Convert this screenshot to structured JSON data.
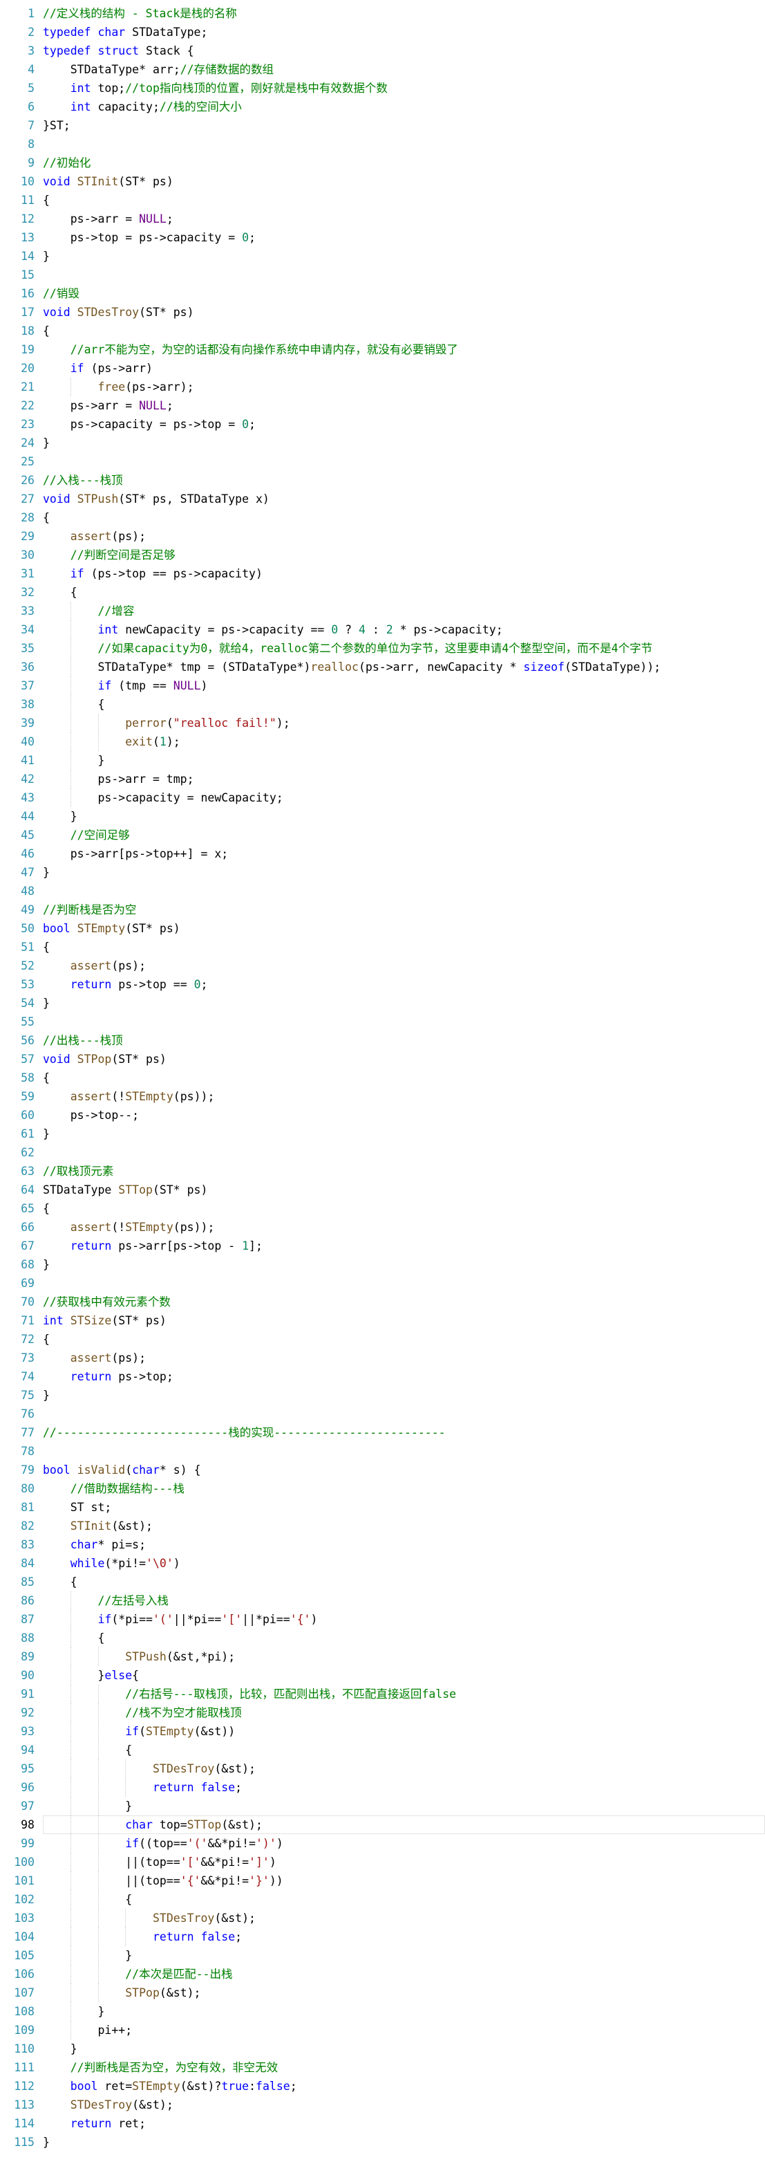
{
  "colors": {
    "background": "#ffffff",
    "line_number": "#2b91af",
    "keyword": "#0000ff",
    "comment": "#008000",
    "function": "#74531f",
    "string": "#a31515",
    "number": "#098658",
    "macro": "#6f008a",
    "text": "#000000"
  },
  "current_line": 98,
  "lines": [
    [
      {
        "t": "//定义栈的结构 - Stack是栈的名称",
        "c": "cm"
      }
    ],
    [
      {
        "t": "typedef ",
        "c": "kw"
      },
      {
        "t": "char ",
        "c": "kw"
      },
      {
        "t": "STDataType;",
        "c": "tx"
      }
    ],
    [
      {
        "t": "typedef ",
        "c": "kw"
      },
      {
        "t": "struct ",
        "c": "kw"
      },
      {
        "t": "Stack {",
        "c": "tx"
      }
    ],
    [
      {
        "t": "    STDataType* arr;",
        "c": "tx"
      },
      {
        "t": "//存储数据的数组",
        "c": "cm"
      }
    ],
    [
      {
        "t": "    ",
        "c": "tx"
      },
      {
        "t": "int ",
        "c": "kw"
      },
      {
        "t": "top;",
        "c": "tx"
      },
      {
        "t": "//top指向栈顶的位置，刚好就是栈中有效数据个数",
        "c": "cm"
      }
    ],
    [
      {
        "t": "    ",
        "c": "tx"
      },
      {
        "t": "int ",
        "c": "kw"
      },
      {
        "t": "capacity;",
        "c": "tx"
      },
      {
        "t": "//栈的空间大小",
        "c": "cm"
      }
    ],
    [
      {
        "t": "}ST;",
        "c": "tx"
      }
    ],
    [],
    [
      {
        "t": "//初始化",
        "c": "cm"
      }
    ],
    [
      {
        "t": "void ",
        "c": "kw"
      },
      {
        "t": "STInit",
        "c": "fn"
      },
      {
        "t": "(ST* ps)",
        "c": "tx"
      }
    ],
    [
      {
        "t": "{",
        "c": "tx"
      }
    ],
    [
      {
        "t": "    ps->arr = ",
        "c": "tx"
      },
      {
        "t": "NULL",
        "c": "mc"
      },
      {
        "t": ";",
        "c": "tx"
      }
    ],
    [
      {
        "t": "    ps->top = ps->capacity = ",
        "c": "tx"
      },
      {
        "t": "0",
        "c": "nm"
      },
      {
        "t": ";",
        "c": "tx"
      }
    ],
    [
      {
        "t": "}",
        "c": "tx"
      }
    ],
    [],
    [
      {
        "t": "//销毁",
        "c": "cm"
      }
    ],
    [
      {
        "t": "void ",
        "c": "kw"
      },
      {
        "t": "STDesTroy",
        "c": "fn"
      },
      {
        "t": "(ST* ps)",
        "c": "tx"
      }
    ],
    [
      {
        "t": "{",
        "c": "tx"
      }
    ],
    [
      {
        "t": "    ",
        "c": "tx"
      },
      {
        "t": "//arr不能为空，为空的话都没有向操作系统中申请内存，就没有必要销毁了",
        "c": "cm"
      }
    ],
    [
      {
        "t": "    ",
        "c": "tx"
      },
      {
        "t": "if ",
        "c": "kw"
      },
      {
        "t": "(ps->arr)",
        "c": "tx"
      }
    ],
    [
      {
        "t": "        ",
        "c": "tx"
      },
      {
        "t": "free",
        "c": "fn"
      },
      {
        "t": "(ps->arr);",
        "c": "tx"
      }
    ],
    [
      {
        "t": "    ps->arr = ",
        "c": "tx"
      },
      {
        "t": "NULL",
        "c": "mc"
      },
      {
        "t": ";",
        "c": "tx"
      }
    ],
    [
      {
        "t": "    ps->capacity = ps->top = ",
        "c": "tx"
      },
      {
        "t": "0",
        "c": "nm"
      },
      {
        "t": ";",
        "c": "tx"
      }
    ],
    [
      {
        "t": "}",
        "c": "tx"
      }
    ],
    [],
    [
      {
        "t": "//入栈---栈顶",
        "c": "cm"
      }
    ],
    [
      {
        "t": "void ",
        "c": "kw"
      },
      {
        "t": "STPush",
        "c": "fn"
      },
      {
        "t": "(ST* ps, STDataType x)",
        "c": "tx"
      }
    ],
    [
      {
        "t": "{",
        "c": "tx"
      }
    ],
    [
      {
        "t": "    ",
        "c": "tx"
      },
      {
        "t": "assert",
        "c": "fn"
      },
      {
        "t": "(ps);",
        "c": "tx"
      }
    ],
    [
      {
        "t": "    ",
        "c": "tx"
      },
      {
        "t": "//判断空间是否足够",
        "c": "cm"
      }
    ],
    [
      {
        "t": "    ",
        "c": "tx"
      },
      {
        "t": "if ",
        "c": "kw"
      },
      {
        "t": "(ps->top == ps->capacity)",
        "c": "tx"
      }
    ],
    [
      {
        "t": "    {",
        "c": "tx"
      }
    ],
    [
      {
        "t": "        ",
        "c": "tx"
      },
      {
        "t": "//增容",
        "c": "cm"
      }
    ],
    [
      {
        "t": "        ",
        "c": "tx"
      },
      {
        "t": "int ",
        "c": "kw"
      },
      {
        "t": "newCapacity = ps->capacity == ",
        "c": "tx"
      },
      {
        "t": "0",
        "c": "nm"
      },
      {
        "t": " ? ",
        "c": "tx"
      },
      {
        "t": "4",
        "c": "nm"
      },
      {
        "t": " : ",
        "c": "tx"
      },
      {
        "t": "2",
        "c": "nm"
      },
      {
        "t": " * ps->capacity;",
        "c": "tx"
      }
    ],
    [
      {
        "t": "        ",
        "c": "tx"
      },
      {
        "t": "//如果capacity为0，就给4，realloc第二个参数的单位为字节，这里要申请4个整型空间，而不是4个字节",
        "c": "cm"
      }
    ],
    [
      {
        "t": "        STDataType* tmp = (STDataType*)",
        "c": "tx"
      },
      {
        "t": "realloc",
        "c": "fn"
      },
      {
        "t": "(ps->arr, newCapacity * ",
        "c": "tx"
      },
      {
        "t": "sizeof",
        "c": "kw"
      },
      {
        "t": "(STDataType));",
        "c": "tx"
      }
    ],
    [
      {
        "t": "        ",
        "c": "tx"
      },
      {
        "t": "if ",
        "c": "kw"
      },
      {
        "t": "(tmp == ",
        "c": "tx"
      },
      {
        "t": "NULL",
        "c": "mc"
      },
      {
        "t": ")",
        "c": "tx"
      }
    ],
    [
      {
        "t": "        {",
        "c": "tx"
      }
    ],
    [
      {
        "t": "            ",
        "c": "tx"
      },
      {
        "t": "perror",
        "c": "fn"
      },
      {
        "t": "(",
        "c": "tx"
      },
      {
        "t": "\"realloc fail!\"",
        "c": "st"
      },
      {
        "t": ");",
        "c": "tx"
      }
    ],
    [
      {
        "t": "            ",
        "c": "tx"
      },
      {
        "t": "exit",
        "c": "fn"
      },
      {
        "t": "(",
        "c": "tx"
      },
      {
        "t": "1",
        "c": "nm"
      },
      {
        "t": ");",
        "c": "tx"
      }
    ],
    [
      {
        "t": "        }",
        "c": "tx"
      }
    ],
    [
      {
        "t": "        ps->arr = tmp;",
        "c": "tx"
      }
    ],
    [
      {
        "t": "        ps->capacity = newCapacity;",
        "c": "tx"
      }
    ],
    [
      {
        "t": "    }",
        "c": "tx"
      }
    ],
    [
      {
        "t": "    ",
        "c": "tx"
      },
      {
        "t": "//空间足够",
        "c": "cm"
      }
    ],
    [
      {
        "t": "    ps->arr[ps->top++] = x;",
        "c": "tx"
      }
    ],
    [
      {
        "t": "}",
        "c": "tx"
      }
    ],
    [],
    [
      {
        "t": "//判断栈是否为空",
        "c": "cm"
      }
    ],
    [
      {
        "t": "bool ",
        "c": "kw"
      },
      {
        "t": "STEmpty",
        "c": "fn"
      },
      {
        "t": "(ST* ps)",
        "c": "tx"
      }
    ],
    [
      {
        "t": "{",
        "c": "tx"
      }
    ],
    [
      {
        "t": "    ",
        "c": "tx"
      },
      {
        "t": "assert",
        "c": "fn"
      },
      {
        "t": "(ps);",
        "c": "tx"
      }
    ],
    [
      {
        "t": "    ",
        "c": "tx"
      },
      {
        "t": "return ",
        "c": "kw"
      },
      {
        "t": "ps->top == ",
        "c": "tx"
      },
      {
        "t": "0",
        "c": "nm"
      },
      {
        "t": ";",
        "c": "tx"
      }
    ],
    [
      {
        "t": "}",
        "c": "tx"
      }
    ],
    [],
    [
      {
        "t": "//出栈---栈顶",
        "c": "cm"
      }
    ],
    [
      {
        "t": "void ",
        "c": "kw"
      },
      {
        "t": "STPop",
        "c": "fn"
      },
      {
        "t": "(ST* ps)",
        "c": "tx"
      }
    ],
    [
      {
        "t": "{",
        "c": "tx"
      }
    ],
    [
      {
        "t": "    ",
        "c": "tx"
      },
      {
        "t": "assert",
        "c": "fn"
      },
      {
        "t": "(!",
        "c": "tx"
      },
      {
        "t": "STEmpty",
        "c": "fn"
      },
      {
        "t": "(ps));",
        "c": "tx"
      }
    ],
    [
      {
        "t": "    ps->top--;",
        "c": "tx"
      }
    ],
    [
      {
        "t": "}",
        "c": "tx"
      }
    ],
    [],
    [
      {
        "t": "//取栈顶元素",
        "c": "cm"
      }
    ],
    [
      {
        "t": "STDataType ",
        "c": "tx"
      },
      {
        "t": "STTop",
        "c": "fn"
      },
      {
        "t": "(ST* ps)",
        "c": "tx"
      }
    ],
    [
      {
        "t": "{",
        "c": "tx"
      }
    ],
    [
      {
        "t": "    ",
        "c": "tx"
      },
      {
        "t": "assert",
        "c": "fn"
      },
      {
        "t": "(!",
        "c": "tx"
      },
      {
        "t": "STEmpty",
        "c": "fn"
      },
      {
        "t": "(ps));",
        "c": "tx"
      }
    ],
    [
      {
        "t": "    ",
        "c": "tx"
      },
      {
        "t": "return ",
        "c": "kw"
      },
      {
        "t": "ps->arr[ps->top - ",
        "c": "tx"
      },
      {
        "t": "1",
        "c": "nm"
      },
      {
        "t": "];",
        "c": "tx"
      }
    ],
    [
      {
        "t": "}",
        "c": "tx"
      }
    ],
    [],
    [
      {
        "t": "//获取栈中有效元素个数",
        "c": "cm"
      }
    ],
    [
      {
        "t": "int ",
        "c": "kw"
      },
      {
        "t": "STSize",
        "c": "fn"
      },
      {
        "t": "(ST* ps)",
        "c": "tx"
      }
    ],
    [
      {
        "t": "{",
        "c": "tx"
      }
    ],
    [
      {
        "t": "    ",
        "c": "tx"
      },
      {
        "t": "assert",
        "c": "fn"
      },
      {
        "t": "(ps);",
        "c": "tx"
      }
    ],
    [
      {
        "t": "    ",
        "c": "tx"
      },
      {
        "t": "return ",
        "c": "kw"
      },
      {
        "t": "ps->top;",
        "c": "tx"
      }
    ],
    [
      {
        "t": "}",
        "c": "tx"
      }
    ],
    [],
    [
      {
        "t": "//-------------------------栈的实现-------------------------",
        "c": "cm"
      }
    ],
    [],
    [
      {
        "t": "bool ",
        "c": "kw"
      },
      {
        "t": "isValid",
        "c": "fn"
      },
      {
        "t": "(",
        "c": "tx"
      },
      {
        "t": "char",
        "c": "kw"
      },
      {
        "t": "* s) {",
        "c": "tx"
      }
    ],
    [
      {
        "t": "    ",
        "c": "tx"
      },
      {
        "t": "//借助数据结构---栈",
        "c": "cm"
      }
    ],
    [
      {
        "t": "    ST st;",
        "c": "tx"
      }
    ],
    [
      {
        "t": "    ",
        "c": "tx"
      },
      {
        "t": "STInit",
        "c": "fn"
      },
      {
        "t": "(&st);",
        "c": "tx"
      }
    ],
    [
      {
        "t": "    ",
        "c": "tx"
      },
      {
        "t": "char",
        "c": "kw"
      },
      {
        "t": "* pi=s;",
        "c": "tx"
      }
    ],
    [
      {
        "t": "    ",
        "c": "tx"
      },
      {
        "t": "while",
        "c": "kw"
      },
      {
        "t": "(*pi!=",
        "c": "tx"
      },
      {
        "t": "'\\0'",
        "c": "st"
      },
      {
        "t": ")",
        "c": "tx"
      }
    ],
    [
      {
        "t": "    {",
        "c": "tx"
      }
    ],
    [
      {
        "t": "        ",
        "c": "tx"
      },
      {
        "t": "//左括号入栈",
        "c": "cm"
      }
    ],
    [
      {
        "t": "        ",
        "c": "tx"
      },
      {
        "t": "if",
        "c": "kw"
      },
      {
        "t": "(*pi==",
        "c": "tx"
      },
      {
        "t": "'('",
        "c": "st"
      },
      {
        "t": "||*pi==",
        "c": "tx"
      },
      {
        "t": "'['",
        "c": "st"
      },
      {
        "t": "||*pi==",
        "c": "tx"
      },
      {
        "t": "'{'",
        "c": "st"
      },
      {
        "t": ")",
        "c": "tx"
      }
    ],
    [
      {
        "t": "        {",
        "c": "tx"
      }
    ],
    [
      {
        "t": "            ",
        "c": "tx"
      },
      {
        "t": "STPush",
        "c": "fn"
      },
      {
        "t": "(&st,*pi);",
        "c": "tx"
      }
    ],
    [
      {
        "t": "        }",
        "c": "tx"
      },
      {
        "t": "else",
        "c": "kw"
      },
      {
        "t": "{",
        "c": "tx"
      }
    ],
    [
      {
        "t": "            ",
        "c": "tx"
      },
      {
        "t": "//右括号---取栈顶，比较，匹配则出栈，不匹配直接返回false",
        "c": "cm"
      }
    ],
    [
      {
        "t": "            ",
        "c": "tx"
      },
      {
        "t": "//栈不为空才能取栈顶",
        "c": "cm"
      }
    ],
    [
      {
        "t": "            ",
        "c": "tx"
      },
      {
        "t": "if",
        "c": "kw"
      },
      {
        "t": "(",
        "c": "tx"
      },
      {
        "t": "STEmpty",
        "c": "fn"
      },
      {
        "t": "(&st))",
        "c": "tx"
      }
    ],
    [
      {
        "t": "            {",
        "c": "tx"
      }
    ],
    [
      {
        "t": "                ",
        "c": "tx"
      },
      {
        "t": "STDesTroy",
        "c": "fn"
      },
      {
        "t": "(&st);",
        "c": "tx"
      }
    ],
    [
      {
        "t": "                ",
        "c": "tx"
      },
      {
        "t": "return ",
        "c": "kw"
      },
      {
        "t": "false",
        "c": "kw"
      },
      {
        "t": ";",
        "c": "tx"
      }
    ],
    [
      {
        "t": "            }",
        "c": "tx"
      }
    ],
    [
      {
        "t": "            ",
        "c": "tx"
      },
      {
        "t": "char ",
        "c": "kw"
      },
      {
        "t": "top=",
        "c": "tx"
      },
      {
        "t": "STTop",
        "c": "fn"
      },
      {
        "t": "(&st);",
        "c": "tx"
      }
    ],
    [
      {
        "t": "            ",
        "c": "tx"
      },
      {
        "t": "if",
        "c": "kw"
      },
      {
        "t": "((top==",
        "c": "tx"
      },
      {
        "t": "'('",
        "c": "st"
      },
      {
        "t": "&&*pi!=",
        "c": "tx"
      },
      {
        "t": "')'",
        "c": "st"
      },
      {
        "t": ")",
        "c": "tx"
      }
    ],
    [
      {
        "t": "            ||(top==",
        "c": "tx"
      },
      {
        "t": "'['",
        "c": "st"
      },
      {
        "t": "&&*pi!=",
        "c": "tx"
      },
      {
        "t": "']'",
        "c": "st"
      },
      {
        "t": ")",
        "c": "tx"
      }
    ],
    [
      {
        "t": "            ||(top==",
        "c": "tx"
      },
      {
        "t": "'{'",
        "c": "st"
      },
      {
        "t": "&&*pi!=",
        "c": "tx"
      },
      {
        "t": "'}'",
        "c": "st"
      },
      {
        "t": "))",
        "c": "tx"
      }
    ],
    [
      {
        "t": "            {",
        "c": "tx"
      }
    ],
    [
      {
        "t": "                ",
        "c": "tx"
      },
      {
        "t": "STDesTroy",
        "c": "fn"
      },
      {
        "t": "(&st);",
        "c": "tx"
      }
    ],
    [
      {
        "t": "                ",
        "c": "tx"
      },
      {
        "t": "return ",
        "c": "kw"
      },
      {
        "t": "false",
        "c": "kw"
      },
      {
        "t": ";",
        "c": "tx"
      }
    ],
    [
      {
        "t": "            }",
        "c": "tx"
      }
    ],
    [
      {
        "t": "            ",
        "c": "tx"
      },
      {
        "t": "//本次是匹配--出栈",
        "c": "cm"
      }
    ],
    [
      {
        "t": "            ",
        "c": "tx"
      },
      {
        "t": "STPop",
        "c": "fn"
      },
      {
        "t": "(&st);",
        "c": "tx"
      }
    ],
    [
      {
        "t": "        }",
        "c": "tx"
      }
    ],
    [
      {
        "t": "        pi++;",
        "c": "tx"
      }
    ],
    [
      {
        "t": "    }",
        "c": "tx"
      }
    ],
    [
      {
        "t": "    ",
        "c": "tx"
      },
      {
        "t": "//判断栈是否为空，为空有效，非空无效",
        "c": "cm"
      }
    ],
    [
      {
        "t": "    ",
        "c": "tx"
      },
      {
        "t": "bool ",
        "c": "kw"
      },
      {
        "t": "ret=",
        "c": "tx"
      },
      {
        "t": "STEmpty",
        "c": "fn"
      },
      {
        "t": "(&st)?",
        "c": "tx"
      },
      {
        "t": "true",
        "c": "kw"
      },
      {
        "t": ":",
        "c": "tx"
      },
      {
        "t": "false",
        "c": "kw"
      },
      {
        "t": ";",
        "c": "tx"
      }
    ],
    [
      {
        "t": "    ",
        "c": "tx"
      },
      {
        "t": "STDesTroy",
        "c": "fn"
      },
      {
        "t": "(&st);",
        "c": "tx"
      }
    ],
    [
      {
        "t": "    ",
        "c": "tx"
      },
      {
        "t": "return ",
        "c": "kw"
      },
      {
        "t": "ret;",
        "c": "tx"
      }
    ],
    [
      {
        "t": "}",
        "c": "tx"
      }
    ]
  ]
}
